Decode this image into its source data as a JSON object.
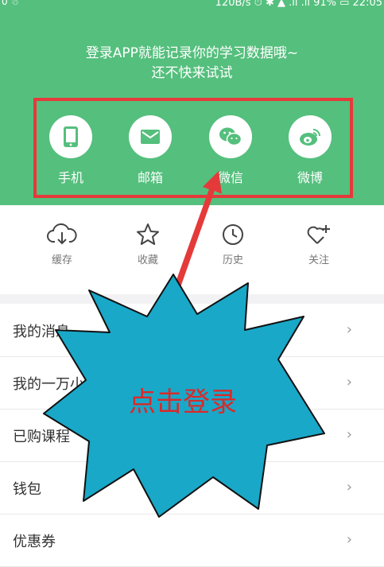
{
  "status_bar": {
    "left": "0 ☃",
    "right": "120B/s ⏱ ✱ ▲ .ıl .ıl 91% ▭ 22:05"
  },
  "header": {
    "promo_line1": "登录APP就能记录你的学习数据哦~",
    "promo_line2": "还不快来试试",
    "login_options": [
      {
        "label": "手机",
        "icon": "phone-icon"
      },
      {
        "label": "邮箱",
        "icon": "mail-icon"
      },
      {
        "label": "微信",
        "icon": "wechat-icon"
      },
      {
        "label": "微博",
        "icon": "weibo-icon"
      }
    ]
  },
  "quick_actions": [
    {
      "label": "缓存",
      "icon": "download-cloud-icon"
    },
    {
      "label": "收藏",
      "icon": "star-icon"
    },
    {
      "label": "历史",
      "icon": "clock-icon"
    },
    {
      "label": "关注",
      "icon": "heart-plus-icon"
    }
  ],
  "menu": [
    {
      "label": "我的消息"
    },
    {
      "label": "我的一万小时"
    },
    {
      "label": "已购课程"
    },
    {
      "label": "钱包"
    },
    {
      "label": "优惠券"
    }
  ],
  "chevron": "›",
  "annotation": {
    "callout_text": "点击登录"
  },
  "colors": {
    "header_green": "#55bf7d",
    "highlight_red": "#e53a3a",
    "callout_blue": "#19a8c8",
    "callout_text": "#d92a2a"
  }
}
